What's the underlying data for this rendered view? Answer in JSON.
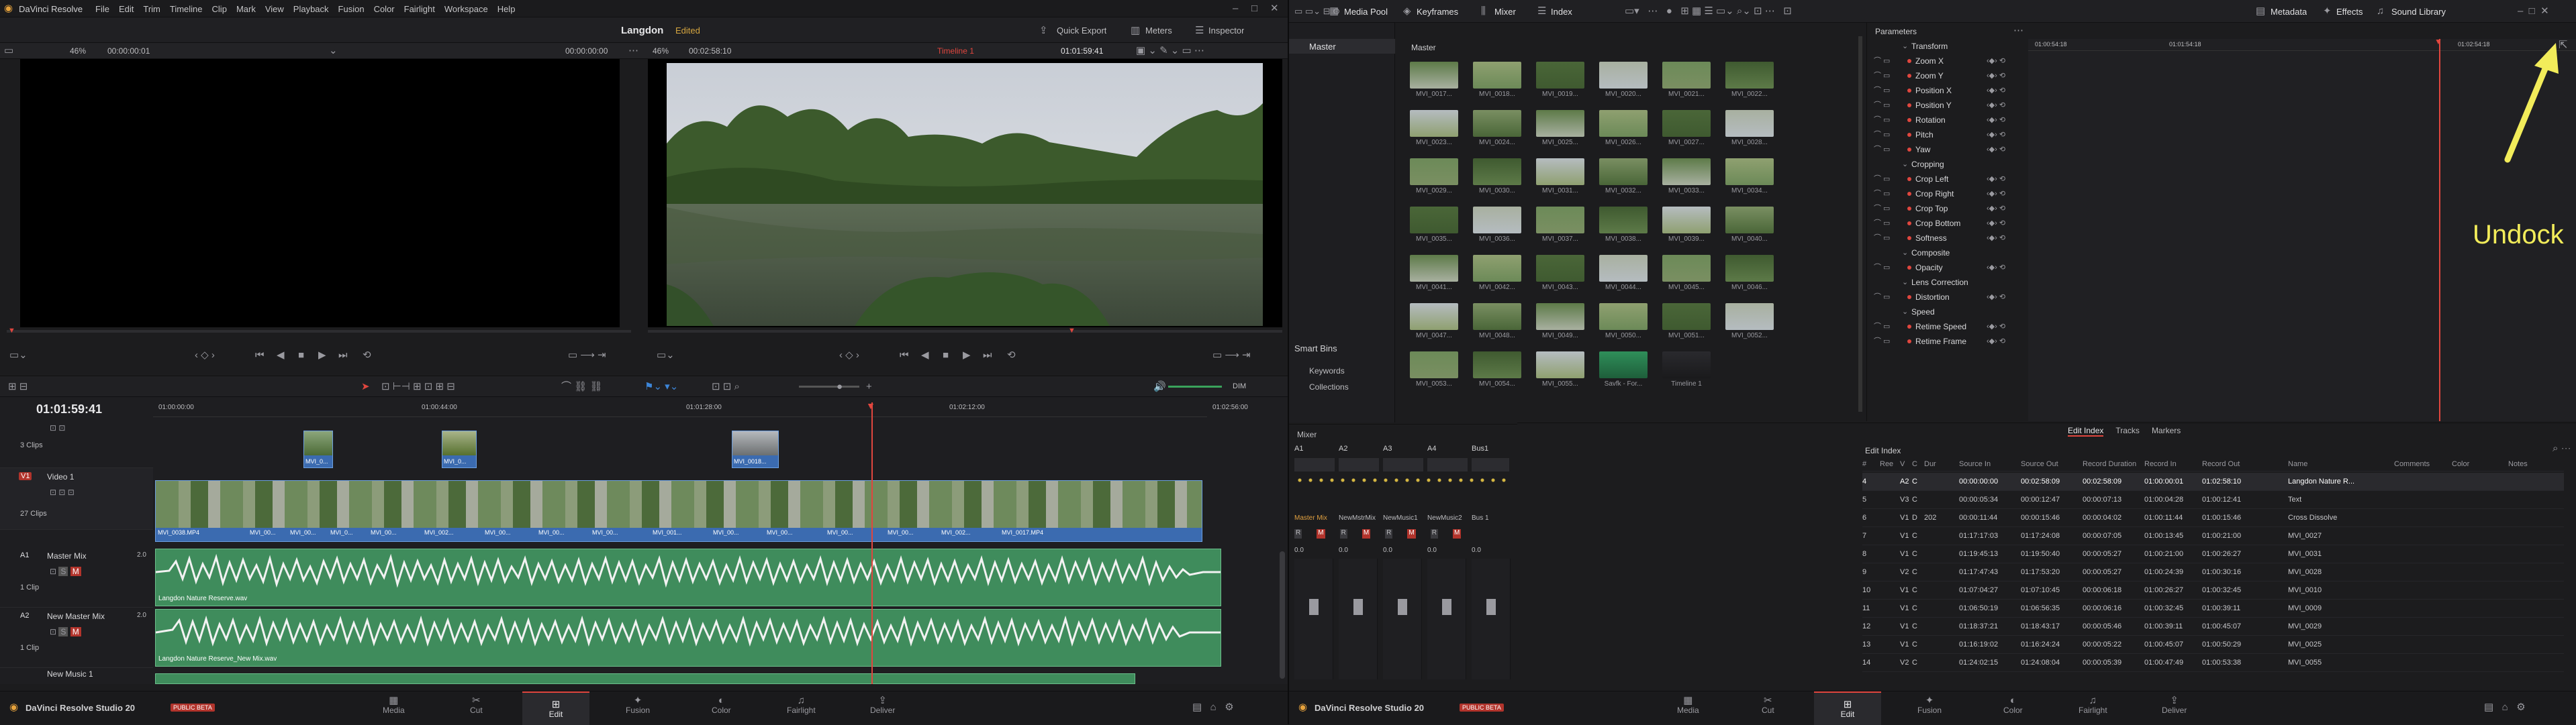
{
  "app": {
    "left_title": "DaVinci Resolve",
    "right_title": "DaVinci Resolve Studio 20",
    "beta_badge": "PUBLIC BETA"
  },
  "menu": [
    "File",
    "Edit",
    "Trim",
    "Timeline",
    "Clip",
    "Mark",
    "View",
    "Playback",
    "Fusion",
    "Color",
    "Fairlight",
    "Workspace",
    "Help"
  ],
  "project": {
    "name": "Langdon",
    "status": "Edited"
  },
  "left_toolbar": {
    "quick_export": "Quick Export",
    "meters": "Meters",
    "inspector": "Inspector"
  },
  "source_viewer": {
    "zoom": "46%",
    "timecode_in": "00:00:00:01",
    "timecode_out": "00:00:00:00"
  },
  "timeline_viewer": {
    "zoom": "46%",
    "duration": "00:02:58:10",
    "timeline_name": "Timeline 1",
    "timecode": "01:01:59:41"
  },
  "timeline": {
    "current_timecode": "01:01:59:41",
    "ruler": [
      "01:00:00:00",
      "01:00:44:00",
      "01:01:28:00",
      "01:02:12:00",
      "01:02:56:00"
    ],
    "dim_label": "DIM",
    "tracks": [
      {
        "id": "",
        "name": "",
        "count": "3 Clips"
      },
      {
        "id": "V1",
        "name": "Video 1",
        "count": "27 Clips"
      },
      {
        "id": "A1",
        "name": "Master Mix",
        "count": "1 Clip",
        "level": "2.0",
        "clip_name": "Langdon Nature Reserve.wav"
      },
      {
        "id": "A2",
        "name": "New Master Mix",
        "count": "1 Clip",
        "level": "2.0",
        "clip_name": "Langdon Nature Reserve_New Mix.wav"
      },
      {
        "id": "A3",
        "name": "New Music 1",
        "count": "",
        "level": "",
        "clip_name": ""
      }
    ],
    "upper_clips": [
      "MVI_0...",
      "MVI_0...",
      "MVI_0018..."
    ],
    "video_clip_labels": [
      "MVI_0038.MP4",
      "MVI_00...",
      "MVI_00...",
      "MVI_0...",
      "MVI_00...",
      "MVI_002...",
      "MVI_00...",
      "MVI_00...",
      "MVI_00...",
      "MVI_001...",
      "MVI_00...",
      "MVI_00...",
      "MVI_00...",
      "MVI_00...",
      "MVI_002...",
      "MVI_0017.MP4"
    ]
  },
  "pages_left": [
    "Media",
    "Cut",
    "Edit",
    "Fusion",
    "Color",
    "Fairlight",
    "Deliver"
  ],
  "pages_right": [
    "Media",
    "Cut",
    "Edit",
    "Fusion",
    "Color",
    "Fairlight",
    "Deliver"
  ],
  "right_toolbar": {
    "media_pool": "Media Pool",
    "keyframes": "Keyframes",
    "mixer": "Mixer",
    "index": "Index",
    "metadata": "Metadata",
    "effects": "Effects",
    "sound_library": "Sound Library"
  },
  "media_pool": {
    "bin_header": "Master",
    "folder": "Master",
    "smart_bins": "Smart Bins",
    "keywords": "Keywords",
    "collections": "Collections",
    "clips": [
      "MVI_0017...",
      "MVI_0018...",
      "MVI_0019...",
      "MVI_0020...",
      "MVI_0021...",
      "MVI_0022...",
      "MVI_0023...",
      "MVI_0024...",
      "MVI_0025...",
      "MVI_0026...",
      "MVI_0027...",
      "MVI_0028...",
      "MVI_0029...",
      "MVI_0030...",
      "MVI_0031...",
      "MVI_0032...",
      "MVI_0033...",
      "MVI_0034...",
      "MVI_0035...",
      "MVI_0036...",
      "MVI_0037...",
      "MVI_0038...",
      "MVI_0039...",
      "MVI_0040...",
      "MVI_0041...",
      "MVI_0042...",
      "MVI_0043...",
      "MVI_0044...",
      "MVI_0045...",
      "MVI_0046...",
      "MVI_0047...",
      "MVI_0048...",
      "MVI_0049...",
      "MVI_0050...",
      "MVI_0051...",
      "MVI_0052...",
      "MVI_0053...",
      "MVI_0054...",
      "MVI_0055...",
      "Savfk - For...",
      "Timeline 1"
    ]
  },
  "mixer": {
    "title": "Mixer",
    "channels": [
      "A1",
      "A2",
      "A3",
      "A4",
      "Bus1"
    ],
    "names": [
      "Master Mix",
      "NewMstrMix",
      "NewMusic1",
      "NewMusic2",
      "Bus 1"
    ],
    "values": [
      "0.0",
      "0.0",
      "0.0",
      "0.0",
      "0.0"
    ]
  },
  "keyframes": {
    "title": "Parameters",
    "ruler": [
      "01:00:54:18",
      "01:01:54:18",
      "01:02:54:18"
    ],
    "annotation": "Undock",
    "params": [
      {
        "name": "Transform",
        "group": true
      },
      {
        "name": "Zoom X"
      },
      {
        "name": "Zoom Y"
      },
      {
        "name": "Position X"
      },
      {
        "name": "Position Y"
      },
      {
        "name": "Rotation"
      },
      {
        "name": "Pitch"
      },
      {
        "name": "Yaw"
      },
      {
        "name": "Cropping",
        "group": true
      },
      {
        "name": "Crop Left"
      },
      {
        "name": "Crop Right"
      },
      {
        "name": "Crop Top"
      },
      {
        "name": "Crop Bottom"
      },
      {
        "name": "Softness"
      },
      {
        "name": "Composite",
        "group": true
      },
      {
        "name": "Opacity"
      },
      {
        "name": "Lens Correction",
        "group": true
      },
      {
        "name": "Distortion"
      },
      {
        "name": "Speed",
        "group": true
      },
      {
        "name": "Retime Speed"
      },
      {
        "name": "Retime Frame"
      }
    ]
  },
  "edit_index": {
    "tabs": [
      "Edit Index",
      "Tracks",
      "Markers"
    ],
    "title": "Edit Index",
    "columns": [
      "#",
      "Ree",
      "V",
      "C",
      "Dur",
      "Source In",
      "Source Out",
      "Record Duration",
      "Record In",
      "Record Out",
      "Name",
      "Comments",
      "Color",
      "Notes"
    ],
    "rows": [
      [
        "4",
        "",
        "A2",
        "C",
        "",
        "00:00:00:00",
        "00:02:58:09",
        "00:02:58:09",
        "01:00:00:01",
        "01:02:58:10",
        "Langdon Nature R..."
      ],
      [
        "5",
        "",
        "V3",
        "C",
        "",
        "00:00:05:34",
        "00:00:12:47",
        "00:00:07:13",
        "01:00:04:28",
        "01:00:12:41",
        "Text"
      ],
      [
        "6",
        "",
        "V1",
        "D",
        "202",
        "00:00:11:44",
        "00:00:15:46",
        "00:00:04:02",
        "01:00:11:44",
        "01:00:15:46",
        "Cross Dissolve"
      ],
      [
        "7",
        "",
        "V1",
        "C",
        "",
        "01:17:17:03",
        "01:17:24:08",
        "00:00:07:05",
        "01:00:13:45",
        "01:00:21:00",
        "MVI_0027"
      ],
      [
        "8",
        "",
        "V1",
        "C",
        "",
        "01:19:45:13",
        "01:19:50:40",
        "00:00:05:27",
        "01:00:21:00",
        "01:00:26:27",
        "MVI_0031"
      ],
      [
        "9",
        "",
        "V2",
        "C",
        "",
        "01:17:47:43",
        "01:17:53:20",
        "00:00:05:27",
        "01:00:24:39",
        "01:00:30:16",
        "MVI_0028"
      ],
      [
        "10",
        "",
        "V1",
        "C",
        "",
        "01:07:04:27",
        "01:07:10:45",
        "00:00:06:18",
        "01:00:26:27",
        "01:00:32:45",
        "MVI_0010"
      ],
      [
        "11",
        "",
        "V1",
        "C",
        "",
        "01:06:50:19",
        "01:06:56:35",
        "00:00:06:16",
        "01:00:32:45",
        "01:00:39:11",
        "MVI_0009"
      ],
      [
        "12",
        "",
        "V1",
        "C",
        "",
        "01:18:37:21",
        "01:18:43:17",
        "00:00:05:46",
        "01:00:39:11",
        "01:00:45:07",
        "MVI_0029"
      ],
      [
        "13",
        "",
        "V1",
        "C",
        "",
        "01:16:19:02",
        "01:16:24:24",
        "00:00:05:22",
        "01:00:45:07",
        "01:00:50:29",
        "MVI_0025"
      ],
      [
        "14",
        "",
        "V2",
        "C",
        "",
        "01:24:02:15",
        "01:24:08:04",
        "00:00:05:39",
        "01:00:47:49",
        "01:00:53:38",
        "MVI_0055"
      ]
    ]
  }
}
